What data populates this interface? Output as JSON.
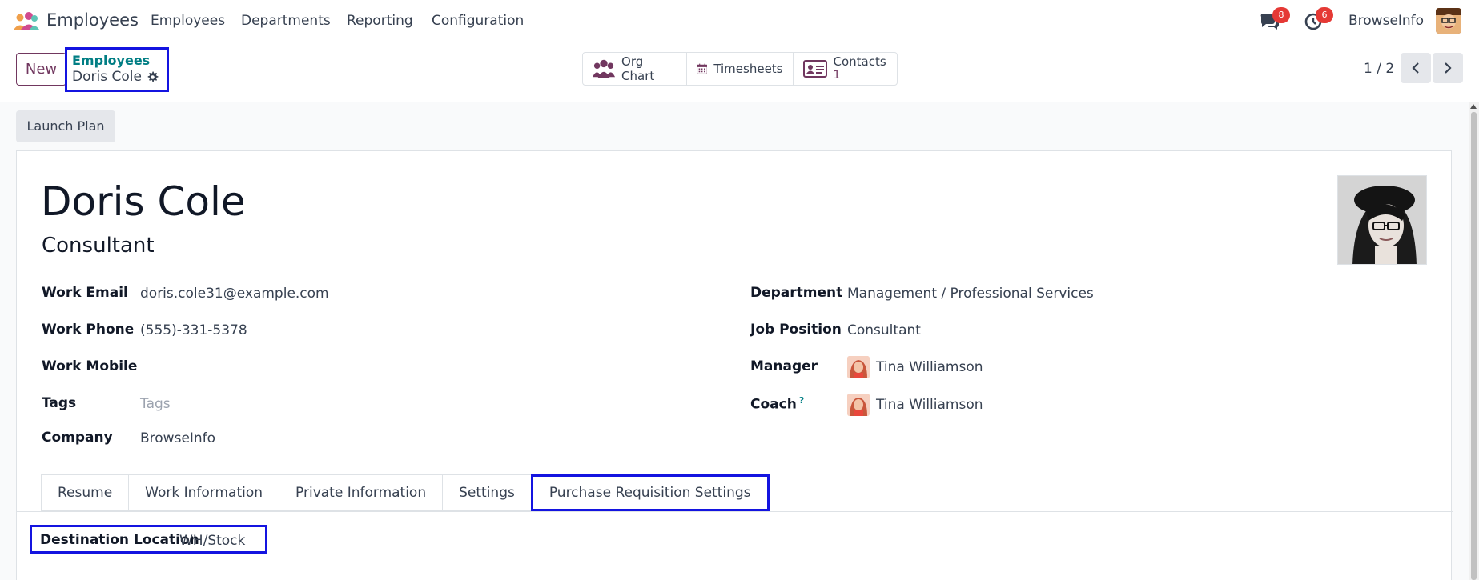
{
  "navbar": {
    "app_name": "Employees",
    "menu": [
      "Employees",
      "Departments",
      "Reporting",
      "Configuration"
    ],
    "messages_count": "8",
    "activities_count": "6",
    "company": "BrowseInfo"
  },
  "control_panel": {
    "new_label": "New",
    "breadcrumb_parent": "Employees",
    "breadcrumb_current": "Doris Cole",
    "smart_buttons": {
      "org_chart": "Org Chart",
      "timesheets": "Timesheets",
      "contacts_label": "Contacts",
      "contacts_count": "1"
    },
    "pager": "1 / 2"
  },
  "status_bar": {
    "launch_plan": "Launch Plan"
  },
  "employee": {
    "name": "Doris Cole",
    "job_title": "Consultant"
  },
  "fields_left": {
    "work_email_label": "Work Email",
    "work_email": "doris.cole31@example.com",
    "work_phone_label": "Work Phone",
    "work_phone": "(555)-331-5378",
    "work_mobile_label": "Work Mobile",
    "tags_label": "Tags",
    "tags_placeholder": "Tags",
    "company_label": "Company",
    "company": "BrowseInfo"
  },
  "fields_right": {
    "department_label": "Department",
    "department": "Management / Professional Services",
    "job_position_label": "Job Position",
    "job_position": "Consultant",
    "manager_label": "Manager",
    "manager": "Tina Williamson",
    "coach_label": "Coach",
    "coach_help": "?",
    "coach": "Tina Williamson"
  },
  "tabs": [
    "Resume",
    "Work Information",
    "Private Information",
    "Settings",
    "Purchase Requisition Settings"
  ],
  "active_tab": "Purchase Requisition Settings",
  "purchase_requisition": {
    "destination_label": "Destination Location",
    "destination_value": "WH/Stock"
  },
  "colors": {
    "brand": "#71375f",
    "teal": "#017e84",
    "highlight": "#1414e0",
    "badge": "#e53935"
  }
}
